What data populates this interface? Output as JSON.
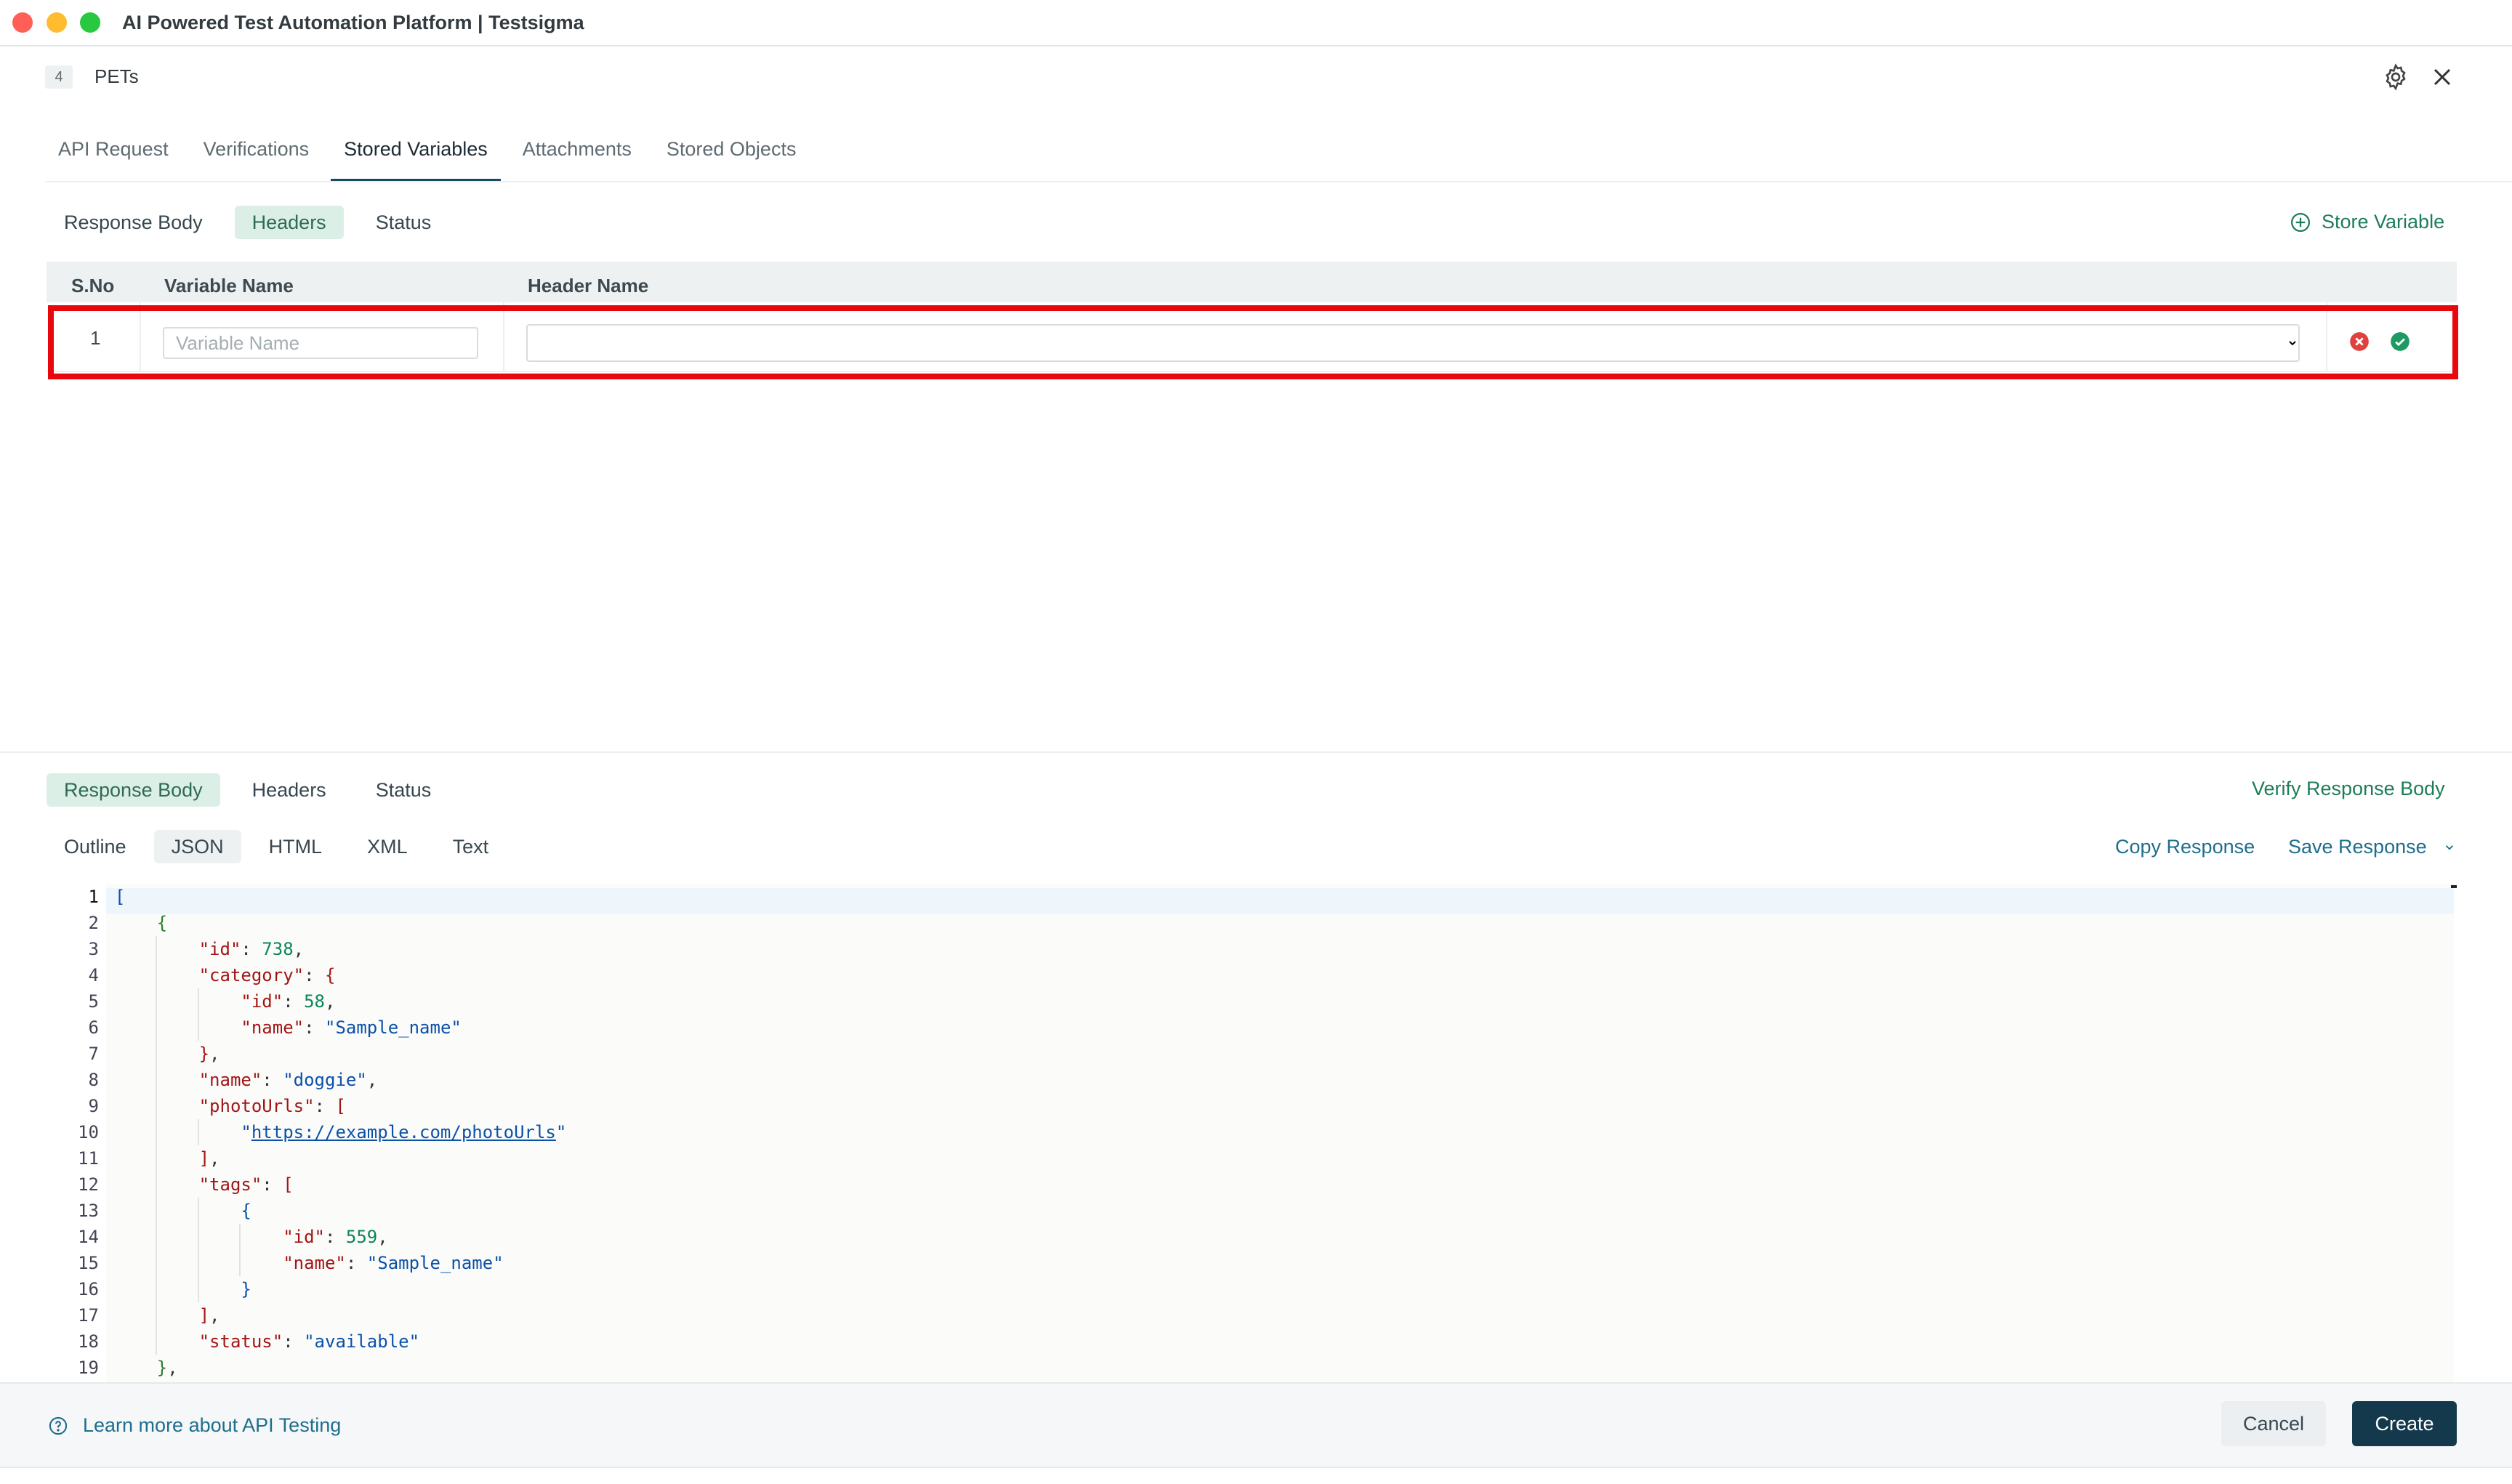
{
  "window": {
    "title": "AI Powered Test Automation Platform | Testsigma"
  },
  "dialog": {
    "step_number": "4",
    "step_name": "PETs"
  },
  "main_tabs": [
    {
      "label": "API Request"
    },
    {
      "label": "Verifications"
    },
    {
      "label": "Stored Variables",
      "active": true
    },
    {
      "label": "Attachments"
    },
    {
      "label": "Stored Objects"
    }
  ],
  "stored_variables": {
    "sub_tabs": [
      {
        "label": "Response Body"
      },
      {
        "label": "Headers",
        "active": true
      },
      {
        "label": "Status"
      }
    ],
    "store_variable_label": "Store Variable",
    "columns": {
      "sno": "S.No",
      "variable_name": "Variable Name",
      "header_name": "Header Name"
    },
    "rows": [
      {
        "sno": "1",
        "variable_name": "",
        "variable_placeholder": "Variable Name",
        "header_name": ""
      }
    ]
  },
  "response": {
    "sub_tabs": [
      {
        "label": "Response Body",
        "active": true
      },
      {
        "label": "Headers"
      },
      {
        "label": "Status"
      }
    ],
    "verify_label": "Verify Response Body",
    "format_tabs": [
      {
        "label": "Outline"
      },
      {
        "label": "JSON",
        "active": true
      },
      {
        "label": "HTML"
      },
      {
        "label": "XML"
      },
      {
        "label": "Text"
      }
    ],
    "copy_label": "Copy Response",
    "save_label": "Save Response",
    "code_lines": [
      "[",
      "    {",
      "        \"id\": 738,",
      "        \"category\": {",
      "            \"id\": 58,",
      "            \"name\": \"Sample_name\"",
      "        },",
      "        \"name\": \"doggie\",",
      "        \"photoUrls\": [",
      "            \"https://example.com/photoUrls\"",
      "        ],",
      "        \"tags\": [",
      "            {",
      "                \"id\": 559,",
      "                \"name\": \"Sample_name\"",
      "            }",
      "        ],",
      "        \"status\": \"available\"",
      "    },"
    ]
  },
  "footer": {
    "learn_more": "Learn more about API Testing",
    "cancel_label": "Cancel",
    "create_label": "Create"
  },
  "colors": {
    "accent_green": "#1e7d58",
    "primary_button": "#14394d",
    "highlight_box": "#e8070c",
    "active_pill": "#dcefe6"
  },
  "icons": {
    "settings": "gear-icon",
    "close": "close-icon",
    "store_variable": "plus-circle-icon",
    "remove_row": "cancel-circle-icon",
    "confirm_row": "check-circle-icon",
    "help": "question-circle-icon",
    "save_dropdown": "chevron-down-icon"
  }
}
